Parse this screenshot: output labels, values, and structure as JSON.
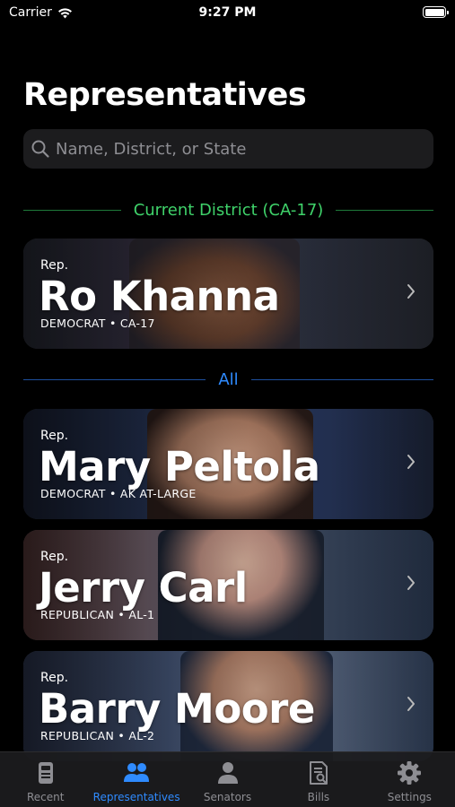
{
  "status_bar": {
    "carrier": "Carrier",
    "time": "9:27 PM"
  },
  "title": "Representatives",
  "search": {
    "placeholder": "Name, District, or State",
    "value": ""
  },
  "sections": {
    "current": "Current District (CA-17)",
    "all": "All"
  },
  "current_rep": {
    "prefix": "Rep.",
    "name": "Ro Khanna",
    "meta": "DEMOCRAT • CA-17"
  },
  "reps": [
    {
      "prefix": "Rep.",
      "name": "Mary Peltola",
      "meta": "DEMOCRAT • AK AT-LARGE"
    },
    {
      "prefix": "Rep.",
      "name": "Jerry Carl",
      "meta": "REPUBLICAN • AL-1"
    },
    {
      "prefix": "Rep.",
      "name": "Barry Moore",
      "meta": "REPUBLICAN • AL-2"
    }
  ],
  "tabs": [
    {
      "label": "Recent",
      "icon": "newspaper-icon"
    },
    {
      "label": "Representatives",
      "icon": "people-icon",
      "active": true
    },
    {
      "label": "Senators",
      "icon": "person-icon"
    },
    {
      "label": "Bills",
      "icon": "document-search-icon"
    },
    {
      "label": "Settings",
      "icon": "gear-icon"
    }
  ],
  "colors": {
    "accent": "#2f8bff",
    "current_district": "#3fd26a",
    "inactive_tab": "#8e8e93"
  }
}
